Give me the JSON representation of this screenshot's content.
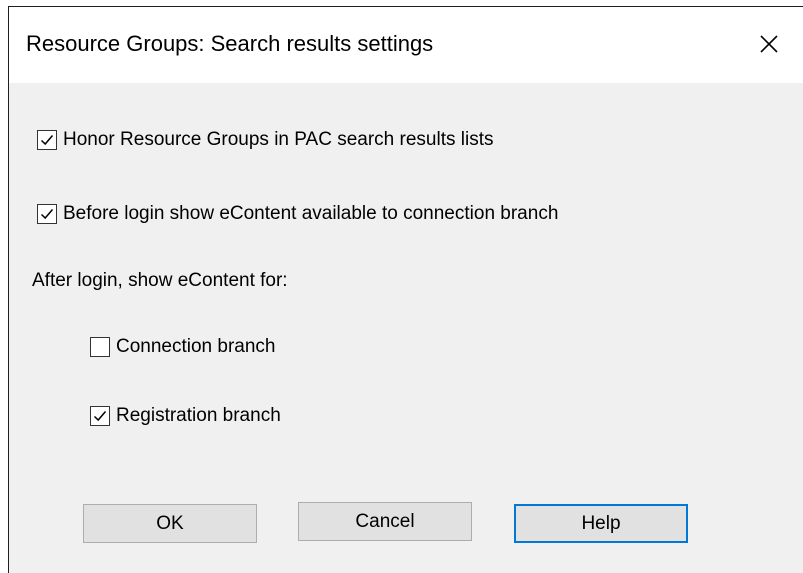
{
  "window": {
    "title": "Resource Groups: Search results settings",
    "close_icon": "close-icon"
  },
  "options": {
    "honor_resource_groups": {
      "label": "Honor Resource Groups in PAC search results lists",
      "checked": true
    },
    "before_login_econtent": {
      "label": "Before login show eContent available to connection branch",
      "checked": true
    },
    "after_login_label": "After login, show eContent for:",
    "connection_branch": {
      "label": "Connection branch",
      "checked": false
    },
    "registration_branch": {
      "label": "Registration branch",
      "checked": true
    }
  },
  "buttons": {
    "ok_label": "OK",
    "cancel_label": "Cancel",
    "help_label": "Help"
  },
  "colors": {
    "title_bg": "#ffffff",
    "dialog_bg": "#f0f0f0",
    "button_bg": "#e1e1e1",
    "default_button_border": "#0078d7"
  }
}
